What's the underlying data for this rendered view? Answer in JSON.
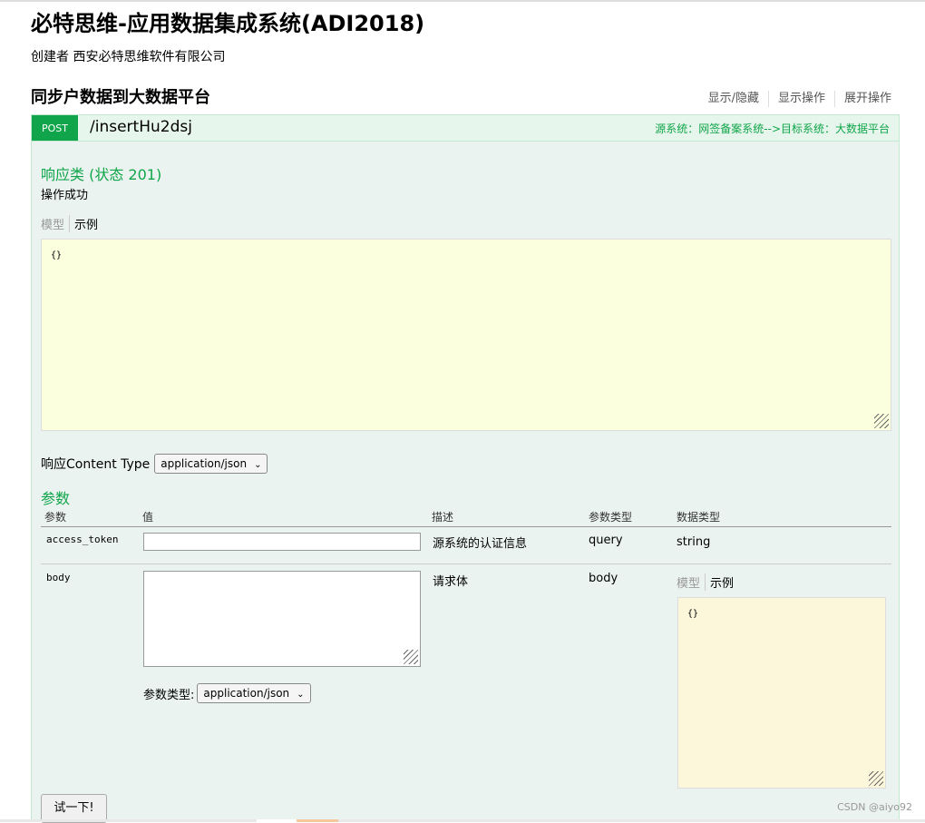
{
  "app": {
    "title": "必特思维-应用数据集成系统(ADI2018)",
    "creator": "创建者 西安必特思维软件有限公司"
  },
  "section": {
    "title": "同步户数据到大数据平台",
    "operations": [
      "显示/隐藏",
      "显示操作",
      "展开操作"
    ]
  },
  "endpoint": {
    "method": "POST",
    "path": "/insertHu2dsj",
    "note": "源系统：网签备案系统-->目标系统：大数据平台",
    "response": {
      "heading": "响应类 (状态 201)",
      "message": "操作成功",
      "tab_model": "模型",
      "tab_example": "示例",
      "sample": "{}",
      "content_type_label": "响应Content Type",
      "content_type_value": "application/json"
    },
    "params": {
      "heading": "参数",
      "columns": [
        "参数",
        "值",
        "描述",
        "参数类型",
        "数据类型"
      ],
      "rows": [
        {
          "name": "access_token",
          "value": "",
          "description": "源系统的认证信息",
          "param_type": "query",
          "data_type": "string"
        },
        {
          "name": "body",
          "value": "",
          "description": "请求体",
          "param_type": "body",
          "data_type_tab_model": "模型",
          "data_type_tab_example": "示例",
          "data_type_sample": "{}"
        }
      ],
      "body_content_type_label": "参数类型:",
      "body_content_type_value": "application/json"
    },
    "try_button": "试一下!"
  },
  "watermark": "CSDN @aiyo92",
  "colors": {
    "accent_green": "#10a54a",
    "panel_bg": "#ebf3f0",
    "sample_bg": "#fcffdd",
    "body_sample_bg": "#fcf6db"
  }
}
